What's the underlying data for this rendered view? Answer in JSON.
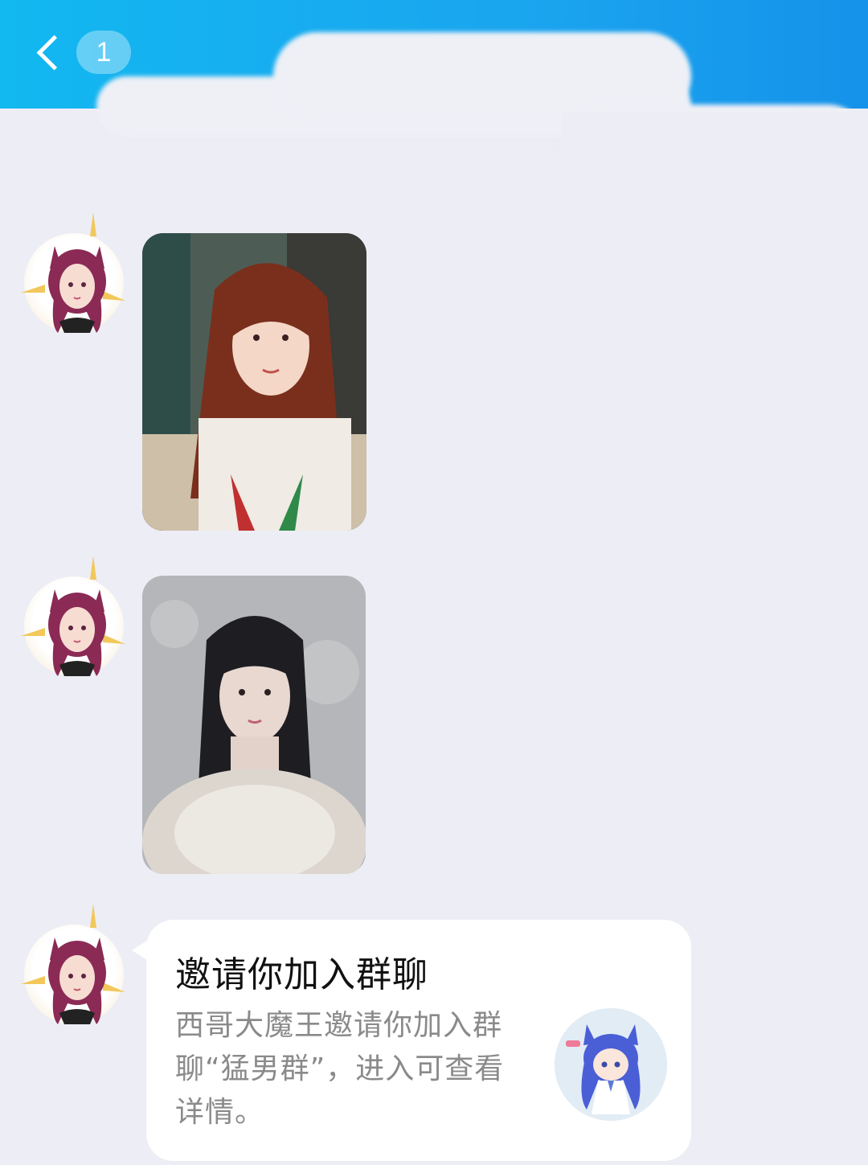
{
  "header": {
    "back_label": "返回",
    "unread_count": "1",
    "background_color": "#1aa5ef"
  },
  "messages": [
    {
      "type": "image",
      "sender_avatar": "cat-ear-girl-avatar",
      "image": "selfie-red-hair"
    },
    {
      "type": "image",
      "sender_avatar": "cat-ear-girl-avatar",
      "image": "photo-dark-hair"
    },
    {
      "type": "group-invite",
      "sender_avatar": "cat-ear-girl-avatar",
      "title": "邀请你加入群聊",
      "description": "西哥大魔王邀请你加入群聊“猛男群”，进入可查看详情。",
      "group_avatar": "blue-hair-chibi-avatar"
    }
  ],
  "colors": {
    "chat_background": "#ededf5",
    "bubble_background": "#ffffff",
    "title_text": "#111111",
    "desc_text": "#8a8a8a"
  }
}
